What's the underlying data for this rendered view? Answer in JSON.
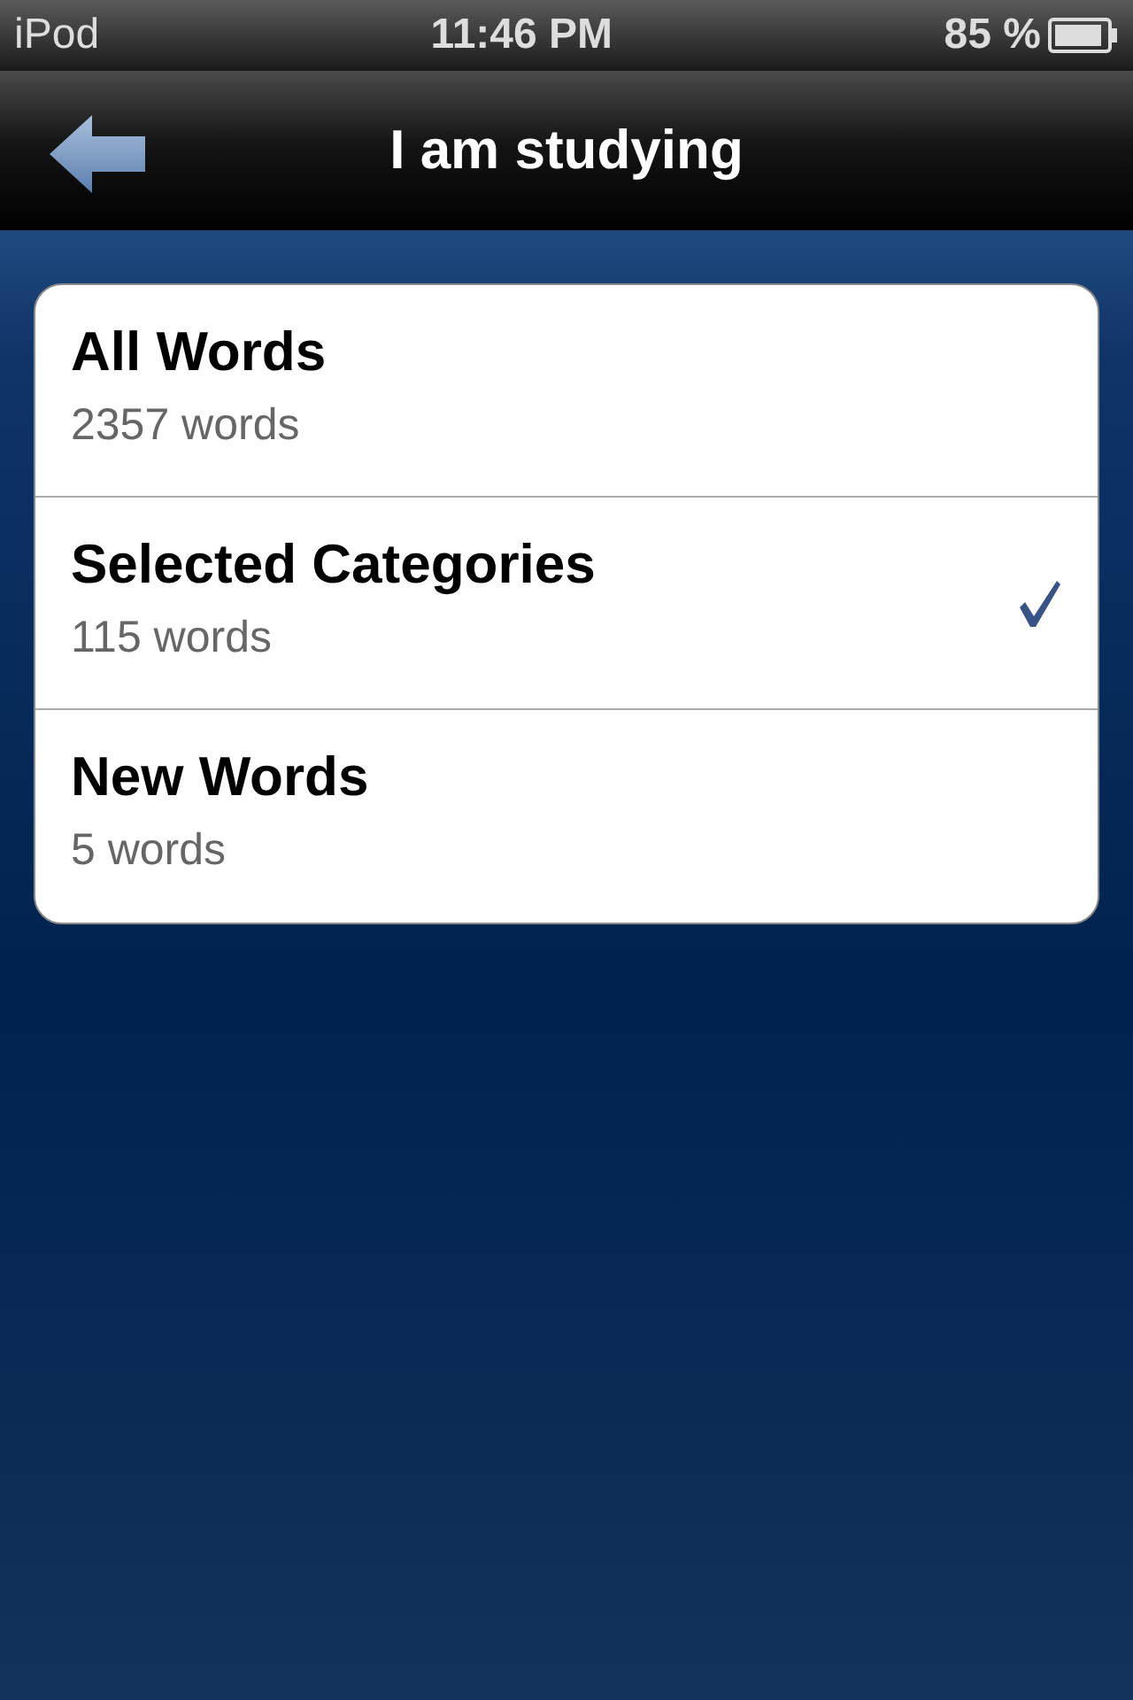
{
  "status_bar": {
    "carrier": "iPod",
    "time": "11:46 PM",
    "battery_text": "85 %"
  },
  "nav_bar": {
    "title": "I am studying"
  },
  "options": [
    {
      "title": "All Words",
      "subtitle": "2357 words",
      "selected": false
    },
    {
      "title": "Selected Categories",
      "subtitle": "115 words",
      "selected": true
    },
    {
      "title": "New Words",
      "subtitle": "5 words",
      "selected": false
    }
  ]
}
